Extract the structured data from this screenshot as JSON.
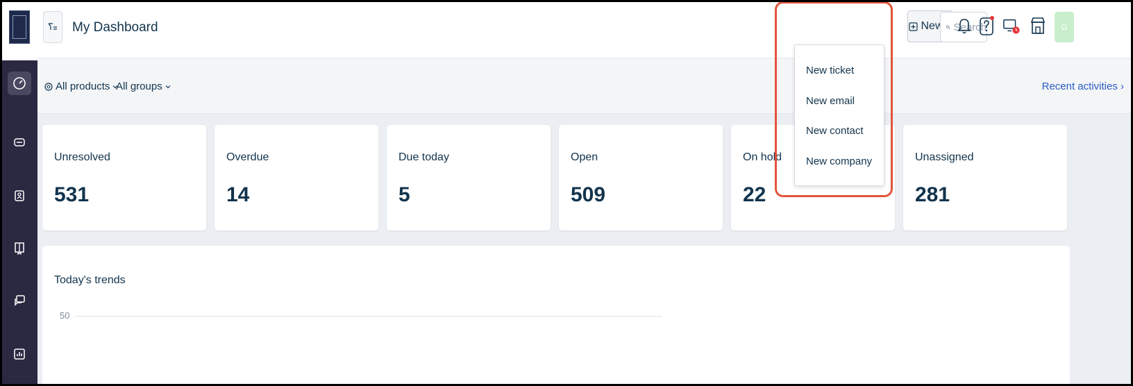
{
  "header": {
    "title": "My Dashboard",
    "new_label": "New",
    "search_placeholder": "Search",
    "avatar_initial": "G"
  },
  "filters": {
    "products": "All products",
    "groups": "All groups",
    "recent_activities": "Recent activities"
  },
  "new_menu": {
    "items": [
      "New ticket",
      "New email",
      "New contact",
      "New company"
    ]
  },
  "stats": [
    {
      "label": "Unresolved",
      "value": "531"
    },
    {
      "label": "Overdue",
      "value": "14"
    },
    {
      "label": "Due today",
      "value": "5"
    },
    {
      "label": "Open",
      "value": "509"
    },
    {
      "label": "On hold",
      "value": "22"
    },
    {
      "label": "Unassigned",
      "value": "281"
    }
  ],
  "trends": {
    "title": "Today's trends",
    "y_tick": "50"
  },
  "colors": {
    "sidebar": "#2b2842",
    "accent_link": "#2c5cc5",
    "highlight": "#e2533a",
    "notification_dot": "#e43538"
  },
  "sidebar_icons": [
    "dashboard-icon",
    "tickets-icon",
    "contacts-icon",
    "knowledge-base-icon",
    "forums-icon",
    "reports-icon"
  ]
}
